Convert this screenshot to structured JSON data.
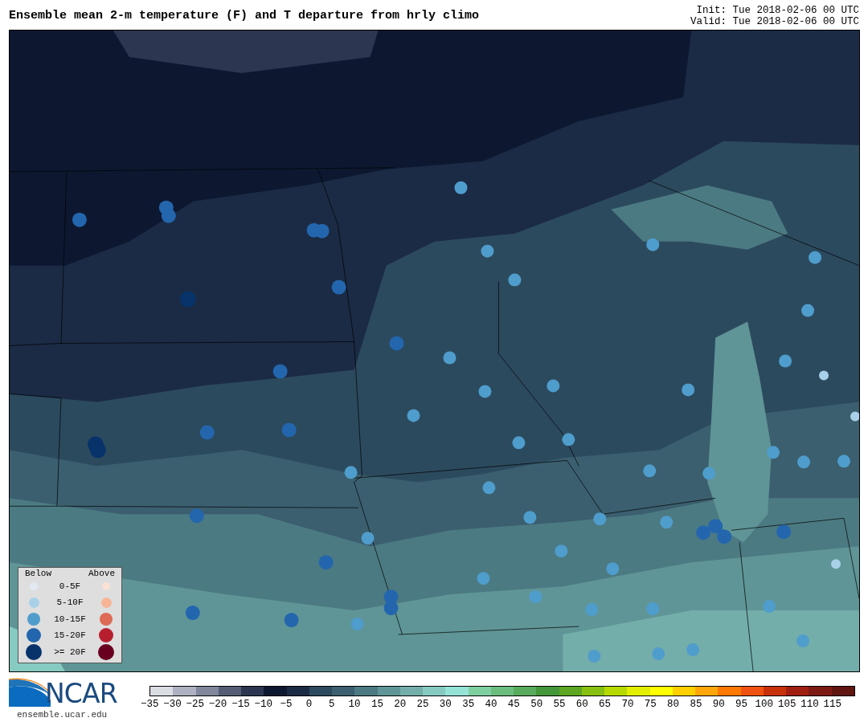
{
  "title": "Ensemble mean 2-m temperature (F) and T departure from hrly climo",
  "init": "Init: Tue 2018-02-06 00 UTC",
  "valid": "Valid: Tue 2018-02-06 00 UTC",
  "legend": {
    "below_header": "Below",
    "above_header": "Above",
    "rows": [
      {
        "label": "0-5F",
        "below": {
          "color": "#e1eaf3"
        },
        "above": {
          "color": "#fbe1d5"
        }
      },
      {
        "label": "5-10F",
        "below": {
          "color": "#a9d0e9"
        },
        "above": {
          "color": "#f7b597"
        }
      },
      {
        "label": "10-15F",
        "below": {
          "color": "#4f9dcc"
        },
        "above": {
          "color": "#de6a55"
        }
      },
      {
        "label": "15-20F",
        "below": {
          "color": "#2366ae"
        },
        "above": {
          "color": "#b81f2e"
        }
      },
      {
        "label": ">= 20F",
        "below": {
          "color": "#08336a"
        },
        "above": {
          "color": "#690020"
        }
      }
    ]
  },
  "logo": {
    "name": "NCAR",
    "url": "ensemble.ucar.edu"
  },
  "colorbar": [
    {
      "label": "−35",
      "color": "#dadde4"
    },
    {
      "label": "−30",
      "color": "#adb1c1"
    },
    {
      "label": "−25",
      "color": "#80879b"
    },
    {
      "label": "−20",
      "color": "#555d75"
    },
    {
      "label": "−15",
      "color": "#2d3650"
    },
    {
      "label": "−10",
      "color": "#0d1830"
    },
    {
      "label": "−5",
      "color": "#1b2b45"
    },
    {
      "label": "0",
      "color": "#2c4a5e"
    },
    {
      "label": "5",
      "color": "#3b5f6f"
    },
    {
      "label": "10",
      "color": "#4c7a82"
    },
    {
      "label": "15",
      "color": "#5f9597"
    },
    {
      "label": "20",
      "color": "#74aeaa"
    },
    {
      "label": "25",
      "color": "#87cac1"
    },
    {
      "label": "30",
      "color": "#95e3d7"
    },
    {
      "label": "35",
      "color": "#7fd0a0"
    },
    {
      "label": "40",
      "color": "#6bbd7e"
    },
    {
      "label": "45",
      "color": "#58aa5d"
    },
    {
      "label": "50",
      "color": "#44963b"
    },
    {
      "label": "55",
      "color": "#5ca621"
    },
    {
      "label": "60",
      "color": "#86c010"
    },
    {
      "label": "65",
      "color": "#b6d900"
    },
    {
      "label": "70",
      "color": "#e3ef00"
    },
    {
      "label": "75",
      "color": "#ffff00"
    },
    {
      "label": "80",
      "color": "#ffd000"
    },
    {
      "label": "85",
      "color": "#ffa70a"
    },
    {
      "label": "90",
      "color": "#ff7800"
    },
    {
      "label": "95",
      "color": "#f05010"
    },
    {
      "label": "100",
      "color": "#c8300a"
    },
    {
      "label": "105",
      "color": "#a01e10"
    },
    {
      "label": "110",
      "color": "#7e1a14"
    },
    {
      "label": "115",
      "color": "#601510"
    }
  ]
}
